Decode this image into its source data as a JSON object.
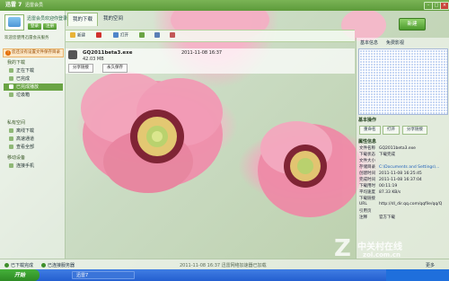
{
  "window": {
    "title": "迅雷 7",
    "badge": "迅雷会员",
    "controls": [
      "-",
      "□",
      "×"
    ]
  },
  "left_panel": {
    "login_text": "迅雷会员欢迎你登录",
    "login_buttons": [
      "登录",
      "注册"
    ],
    "info_line": "欢迎您使用迅雷会员服务",
    "warning": "您还没有设置文件保存目录",
    "sections": [
      {
        "title": "我的下载",
        "items": [
          "正在下载",
          "已完成",
          "已完成播放",
          "垃圾箱"
        ]
      },
      {
        "title": "私有空间",
        "items": [
          "离线下载",
          "高速通道",
          "查看全部"
        ]
      },
      {
        "title": "移动设备",
        "items": [
          "连接手机"
        ]
      }
    ],
    "active_item_index": 2
  },
  "tabs": [
    "我的下载",
    "我的空间"
  ],
  "new_task_label": "新建",
  "toolbar": {
    "buttons": [
      {
        "label": "新建",
        "icon": "folder-icon",
        "color": "#e8b337"
      },
      {
        "label": "",
        "icon": "delete-icon",
        "color": "#d0322d"
      },
      {
        "label": "打开",
        "icon": "open-icon",
        "color": "#4f85c9"
      },
      {
        "label": "",
        "icon": "settings-icon",
        "color": "#6aa444"
      },
      {
        "label": "",
        "icon": "grid-icon",
        "color": "#5b7fb5"
      },
      {
        "label": "",
        "icon": "image-icon",
        "color": "#c25757"
      }
    ]
  },
  "task": {
    "name": "GQ2011beta3.exe",
    "size": "42.03 MB",
    "date": "2011-11-08 16:37",
    "buttons": [
      "分享链接",
      "永久保存"
    ]
  },
  "right_panel": {
    "tabs": [
      "基本信息",
      "免费影视"
    ],
    "actions_title": "基本操作",
    "actions": [
      "重命名",
      "打开",
      "分享链接"
    ],
    "attributes_title": "属性信息",
    "attributes": [
      {
        "k": "文件名称",
        "v": "GQ2011beta3.exe",
        "link": false
      },
      {
        "k": "下载状态",
        "v": "下载完成",
        "link": false
      },
      {
        "k": "文件大小",
        "v": "",
        "link": false
      },
      {
        "k": "存储目录",
        "v": "C:\\Documents and Settings\\...",
        "link": true
      },
      {
        "k": "创建时间",
        "v": "2011-11-08 16:25:45",
        "link": false
      },
      {
        "k": "完成时间",
        "v": "2011-11-08 16:37:04",
        "link": false
      },
      {
        "k": "下载用时",
        "v": "00:11:19",
        "link": false
      },
      {
        "k": "平均速度",
        "v": "87.33 KB/s",
        "link": false
      },
      {
        "k": "下载链接",
        "v": "",
        "link": false
      },
      {
        "k": "URL",
        "v": "http://dl_dir.qq.com/qqfile/qq/Q",
        "link": false
      },
      {
        "k": "引用页",
        "v": "",
        "link": false
      },
      {
        "k": "注释",
        "v": "官方下载",
        "link": false
      }
    ]
  },
  "bottom_bar": {
    "items": [
      "已下载完成",
      "已连接服务器",
      "2011-11-08 16:37 迅雷网络加速器已加载"
    ],
    "right": "更多"
  },
  "taskbar": {
    "start": "开始",
    "window": "迅雷7"
  },
  "watermark": {
    "text": "中关村在线",
    "domain": "zol.com.cn"
  }
}
